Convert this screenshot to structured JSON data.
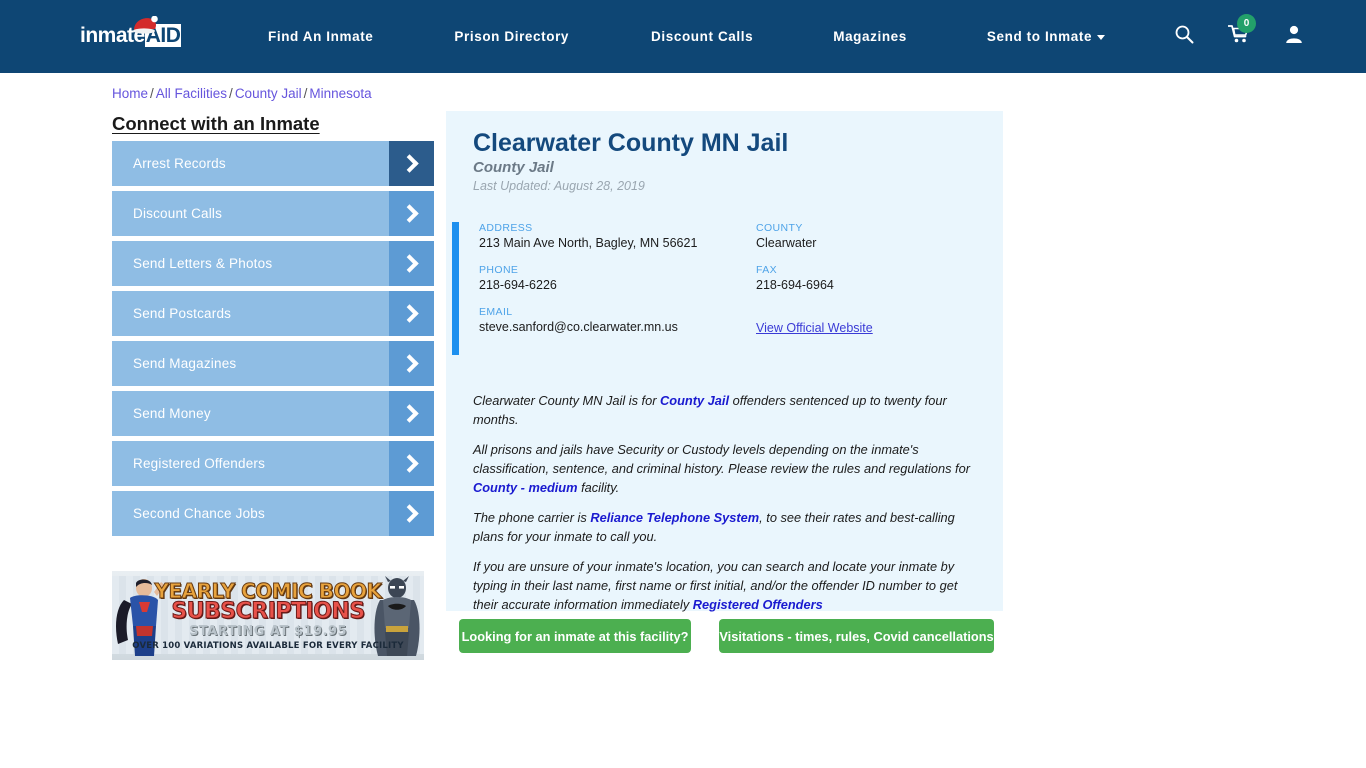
{
  "header": {
    "logo_text": "inmate",
    "logo_accent": "AID",
    "logo_icon": "santa-hat-icon",
    "nav": [
      {
        "label": "Find An Inmate"
      },
      {
        "label": "Prison Directory"
      },
      {
        "label": "Discount Calls"
      },
      {
        "label": "Magazines"
      },
      {
        "label": "Send to Inmate"
      }
    ],
    "icons": {
      "search": "search-icon",
      "cart": "shopping-cart-icon",
      "cart_count": "0",
      "account": "user-account-icon"
    },
    "colors": {
      "bar": "#0e4674",
      "badge": "#23a06a"
    }
  },
  "breadcrumb": {
    "items": [
      "Home",
      "All Facilities",
      "County Jail",
      "Minnesota"
    ],
    "separator": "/"
  },
  "sidebar": {
    "title": "Connect with an Inmate",
    "items": [
      {
        "label": "Arrest Records",
        "arrow": "chevron-right-icon",
        "highlighted": true
      },
      {
        "label": "Discount Calls",
        "arrow": "chevron-right-icon",
        "highlighted": false
      },
      {
        "label": "Send Letters & Photos",
        "arrow": "chevron-right-icon",
        "highlighted": false
      },
      {
        "label": "Send Postcards",
        "arrow": "chevron-right-icon",
        "highlighted": false
      },
      {
        "label": "Send Magazines",
        "arrow": "chevron-right-icon",
        "highlighted": false
      },
      {
        "label": "Send Money",
        "arrow": "chevron-right-icon",
        "highlighted": false
      },
      {
        "label": "Registered Offenders",
        "arrow": "chevron-right-icon",
        "highlighted": false
      },
      {
        "label": "Second Chance Jobs",
        "arrow": "chevron-right-icon",
        "highlighted": false
      }
    ]
  },
  "ad": {
    "line1": "YEARLY COMIC BOOK",
    "line2": "SUBSCRIPTIONS",
    "line3": "STARTING AT $19.95",
    "line4": "OVER 100 VARIATIONS AVAILABLE FOR EVERY FACILITY"
  },
  "facility": {
    "title": "Clearwater County MN Jail",
    "subtitle": "County Jail",
    "last_updated": "Last Updated: August 28, 2019",
    "fields": {
      "address_label": "ADDRESS",
      "address_value": "213 Main Ave North, Bagley, MN 56621",
      "county_label": "COUNTY",
      "county_value": "Clearwater",
      "phone_label": "PHONE",
      "phone_value": "218-694-6226",
      "fax_label": "FAX",
      "fax_value": "218-694-6964",
      "email_label": "EMAIL",
      "email_value": "steve.sanford@co.clearwater.mn.us",
      "website_link": "View Official Website"
    },
    "description": {
      "p1_a": "Clearwater County MN Jail is for ",
      "p1_link": "County Jail",
      "p1_b": " offenders sentenced up to twenty four months.",
      "p2_a": "All prisons and jails have Security or Custody levels depending on the inmate's classification, sentence, and criminal history. Please review the rules and regulations for ",
      "p2_link": "County - medium",
      "p2_b": " facility.",
      "p3_a": "The phone carrier is ",
      "p3_link": "Reliance Telephone System",
      "p3_b": ", to see their rates and best-calling plans for your inmate to call you.",
      "p4_a": "If you are unsure of your inmate's location, you can search and locate your inmate by typing in their last name, first name or first initial, and/or the offender ID number to get their accurate information immediately ",
      "p4_link": "Registered Offenders"
    }
  },
  "cta": {
    "primary": "Looking for an inmate at this facility?",
    "secondary": "Visitations - times, rules, Covid cancellations",
    "color": "#4caf50"
  }
}
